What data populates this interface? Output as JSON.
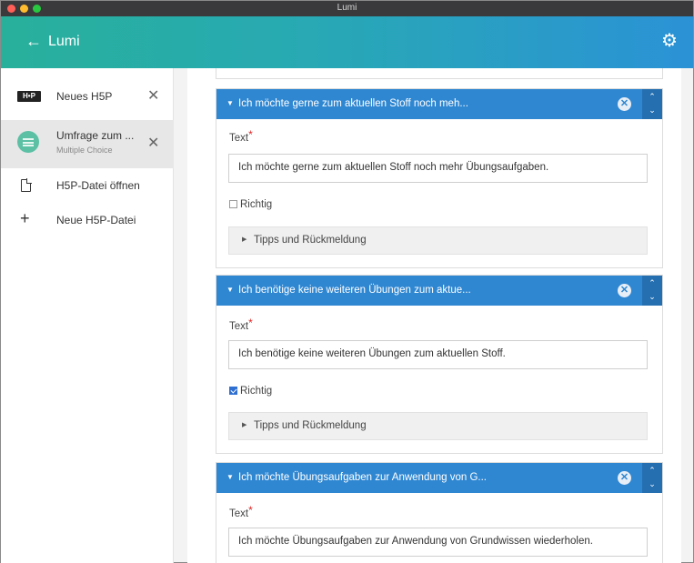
{
  "window": {
    "title": "Lumi"
  },
  "appbar": {
    "back_icon": "arrow-left-icon",
    "title": "Lumi",
    "settings_icon": "gear-icon"
  },
  "sidebar": {
    "tabs": [
      {
        "badge": "H•P",
        "label": "Neues H5P",
        "close": "✕"
      },
      {
        "label": "Umfrage zum ...",
        "sublabel": "Multiple Choice",
        "close": "✕"
      }
    ],
    "actions": [
      {
        "icon": "file-icon",
        "label": "H5P-Datei öffnen"
      },
      {
        "icon": "plus-icon",
        "symbol": "+",
        "label": "Neue H5P-Datei"
      }
    ]
  },
  "editor": {
    "field_label": "Text",
    "required_mark": "*",
    "correct_label": "Richtig",
    "feedback_label": "Tipps und Rückmeldung",
    "remove_symbol": "✕",
    "up_symbol": "⌃",
    "down_symbol": "⌄",
    "answers": [
      {
        "header": "Ich möchte gerne zum aktuellen Stoff noch meh...",
        "text": "Ich möchte gerne zum aktuellen Stoff noch mehr Übungsaufgaben.",
        "correct": false
      },
      {
        "header": "Ich benötige keine weiteren Übungen zum aktue...",
        "text": "Ich benötige keine weiteren Übungen zum aktuellen Stoff.",
        "correct": true
      },
      {
        "header": "Ich möchte Übungsaufgaben zur Anwendung von G...",
        "text": "Ich möchte Übungsaufgaben zur Anwendung von Grundwissen wiederholen."
      }
    ]
  },
  "colors": {
    "accent": "#2f87d2",
    "appbar_start": "#29b09b",
    "appbar_end": "#2b92d6",
    "required": "#e02424"
  }
}
